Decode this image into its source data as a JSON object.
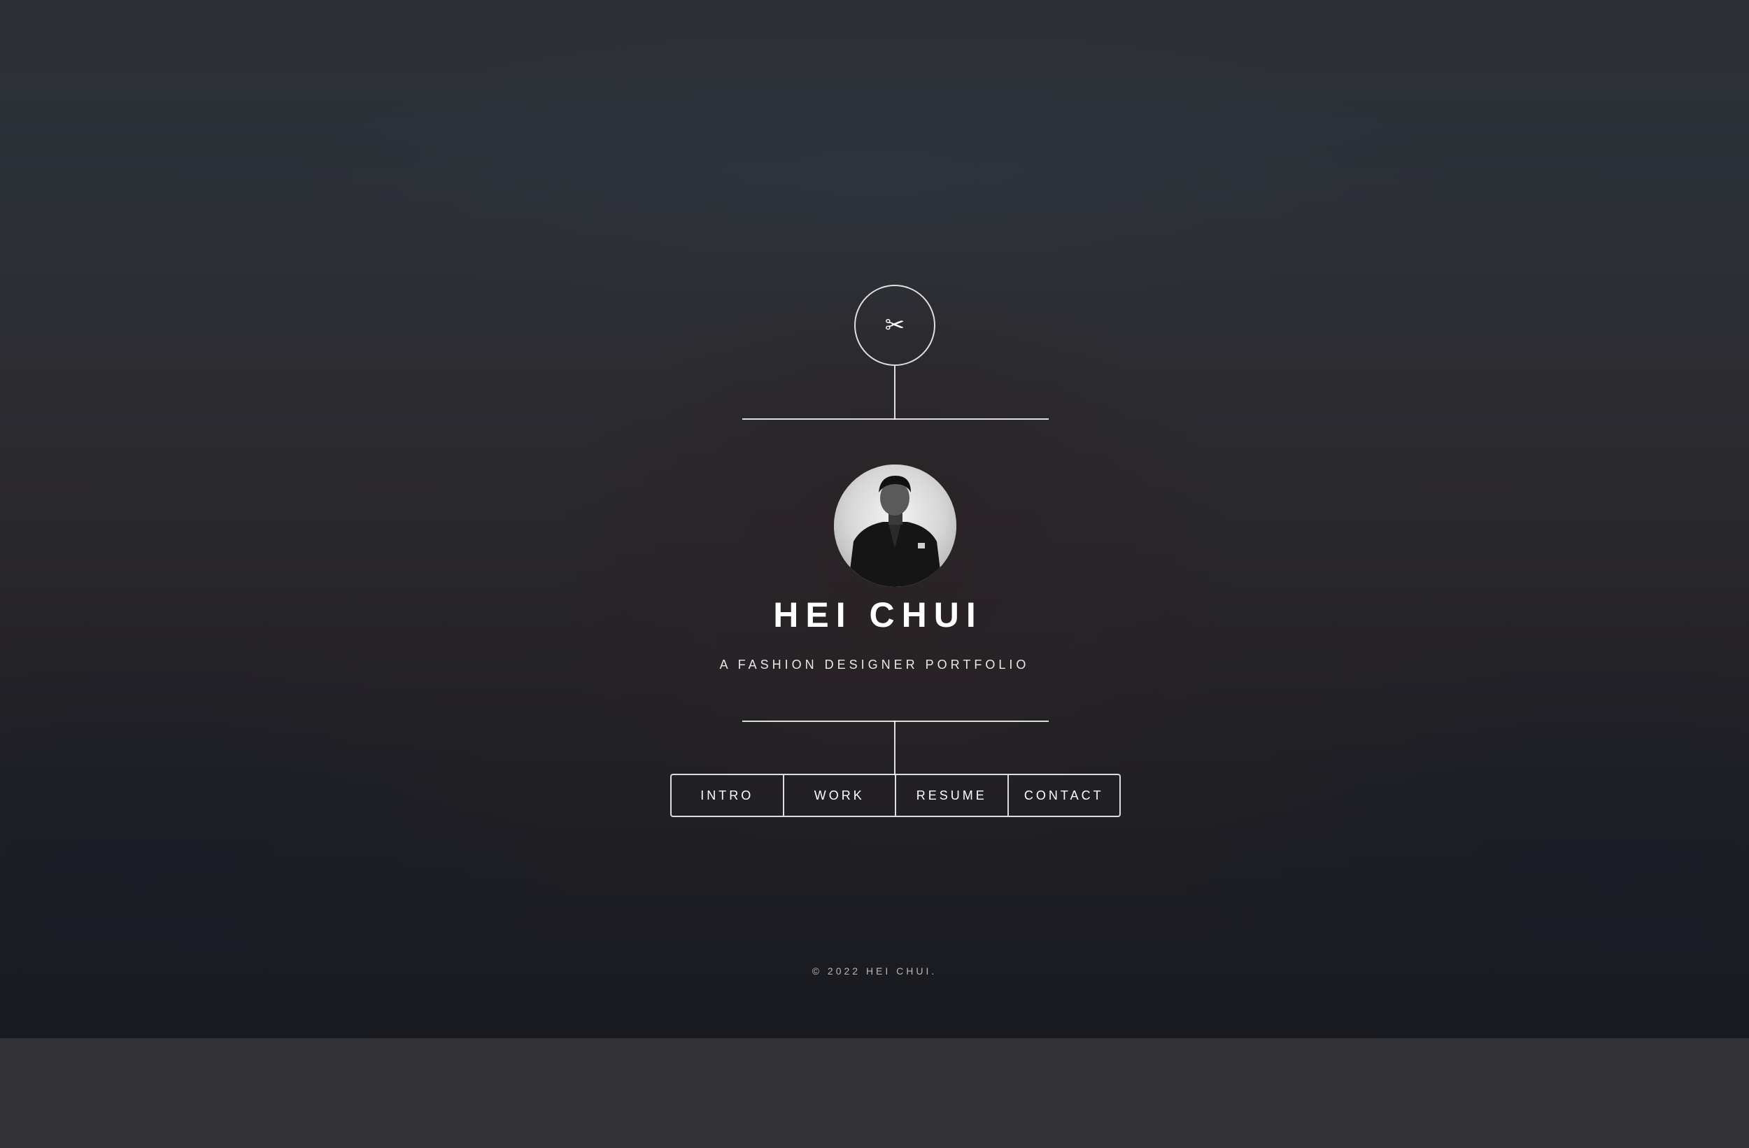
{
  "header": {
    "logo_glyph": "✂",
    "logo_icon": "scissors-icon"
  },
  "profile": {
    "avatar_icon": "profile-photo",
    "name": "HEI CHUI",
    "tagline": "A FASHION DESIGNER PORTFOLIO"
  },
  "nav": {
    "items": [
      {
        "label": "INTRO"
      },
      {
        "label": "WORK"
      },
      {
        "label": "RESUME"
      },
      {
        "label": "CONTACT"
      }
    ]
  },
  "footer": {
    "copyright": "© 2022 HEI CHUI."
  },
  "colors": {
    "background_top": "#2f3035",
    "background_bottom": "#181a20",
    "band": "#323237",
    "line": "#ffffff",
    "text": "#ffffff"
  }
}
